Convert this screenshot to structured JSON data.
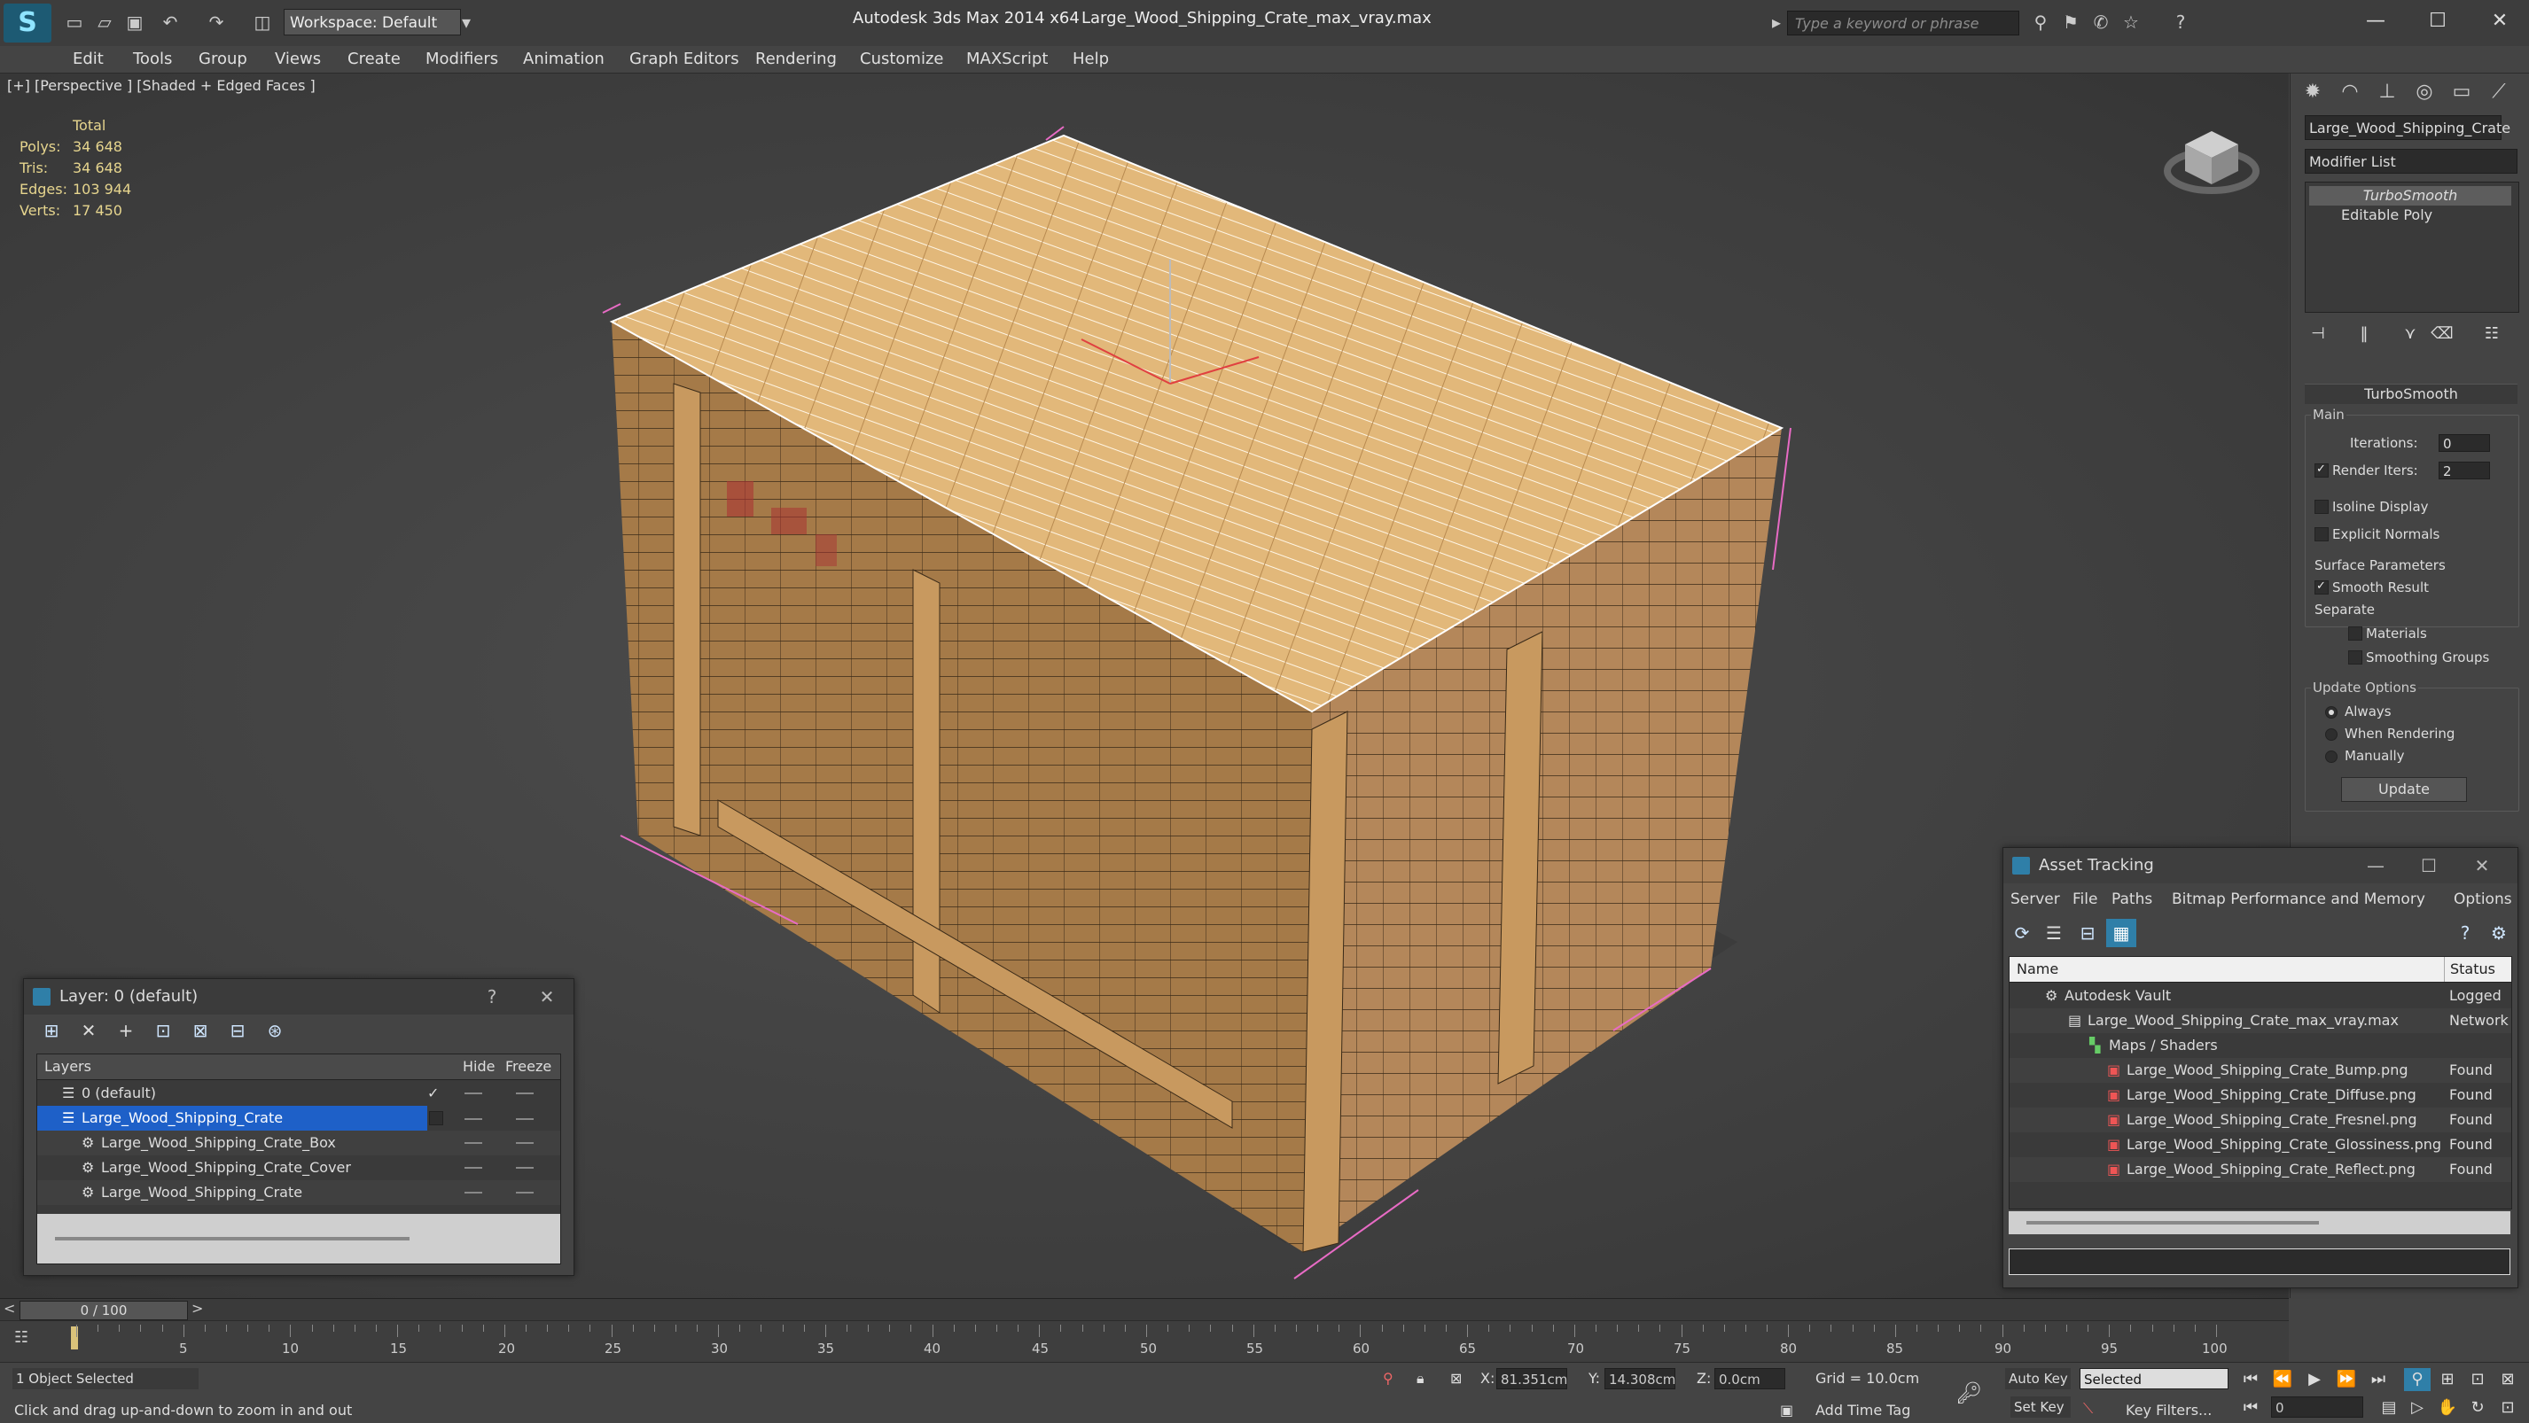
{
  "app": {
    "logo": "S",
    "workspace": "Workspace: Default",
    "title_app": "Autodesk 3ds Max  2014 x64",
    "title_file": "Large_Wood_Shipping_Crate_max_vray.max",
    "search_placeholder": "Type a keyword or phrase"
  },
  "menu": [
    "Edit",
    "Tools",
    "Group",
    "Views",
    "Create",
    "Modifiers",
    "Animation",
    "Graph Editors",
    "Rendering",
    "Customize",
    "MAXScript",
    "Help"
  ],
  "viewport": {
    "label": "[+] [Perspective ] [Shaded + Edged Faces ]",
    "stats": {
      "header": "Total",
      "rows": [
        {
          "k": "Polys:",
          "v": "34 648"
        },
        {
          "k": "Tris:",
          "v": "34 648"
        },
        {
          "k": "Edges:",
          "v": "103 944"
        },
        {
          "k": "Verts:",
          "v": "17 450"
        }
      ]
    }
  },
  "command_panel": {
    "object_name": "Large_Wood_Shipping_Crate",
    "modifier_list": "Modifier List",
    "stack": [
      "TurboSmooth",
      "Editable Poly"
    ],
    "rollout": "TurboSmooth",
    "main_group": "Main",
    "iterations_label": "Iterations:",
    "iterations_value": "0",
    "render_iters_label": "Render Iters:",
    "render_iters_value": "2",
    "isoline": "Isoline Display",
    "explicit_normals": "Explicit Normals",
    "surface_params": "Surface Parameters",
    "smooth_result": "Smooth Result",
    "separate": "Separate",
    "materials": "Materials",
    "smoothing_groups": "Smoothing Groups",
    "update_options": "Update Options",
    "always": "Always",
    "when_rendering": "When Rendering",
    "manually": "Manually",
    "update_btn": "Update"
  },
  "layer_window": {
    "title": "Layer: 0 (default)",
    "help": "?",
    "col_layers": "Layers",
    "col_hide": "Hide",
    "col_freeze": "Freeze",
    "rows": [
      {
        "name": "0 (default)",
        "indent": 1
      },
      {
        "name": "Large_Wood_Shipping_Crate",
        "indent": 1
      },
      {
        "name": "Large_Wood_Shipping_Crate_Box",
        "indent": 2
      },
      {
        "name": "Large_Wood_Shipping_Crate_Cover",
        "indent": 2
      },
      {
        "name": "Large_Wood_Shipping_Crate",
        "indent": 2
      }
    ]
  },
  "asset_window": {
    "title": "Asset Tracking",
    "menu": [
      "Server",
      "File",
      "Paths",
      "Bitmap Performance and Memory",
      "Options"
    ],
    "col_name": "Name",
    "col_status": "Status",
    "rows": [
      {
        "name": "Autodesk Vault",
        "status": "Logged",
        "indent": 1
      },
      {
        "name": "Large_Wood_Shipping_Crate_max_vray.max",
        "status": "Network",
        "indent": 2
      },
      {
        "name": "Maps / Shaders",
        "status": "",
        "indent": 3
      },
      {
        "name": "Large_Wood_Shipping_Crate_Bump.png",
        "status": "Found",
        "indent": 4
      },
      {
        "name": "Large_Wood_Shipping_Crate_Diffuse.png",
        "status": "Found",
        "indent": 4
      },
      {
        "name": "Large_Wood_Shipping_Crate_Fresnel.png",
        "status": "Found",
        "indent": 4
      },
      {
        "name": "Large_Wood_Shipping_Crate_Glossiness.png",
        "status": "Found",
        "indent": 4
      },
      {
        "name": "Large_Wood_Shipping_Crate_Reflect.png",
        "status": "Found",
        "indent": 4
      }
    ]
  },
  "timeline": {
    "slider": "0 / 100",
    "ticks": [
      "5",
      "10",
      "15",
      "20",
      "25",
      "30",
      "35",
      "40",
      "45",
      "50",
      "55",
      "60",
      "65",
      "70",
      "75",
      "80",
      "85",
      "90",
      "95",
      "100"
    ]
  },
  "status": {
    "selected": "1 Object Selected",
    "prompt": "Click and drag up-and-down to zoom in and out",
    "x_label": "X:",
    "x": "81.351cm",
    "y_label": "Y:",
    "y": "14.308cm",
    "z_label": "Z:",
    "z": "0.0cm",
    "grid": "Grid = 10.0cm",
    "add_time_tag": "Add Time Tag",
    "auto_key": "Auto Key",
    "set_key": "Set Key",
    "selected_dropdown": "Selected",
    "key_filters": "Key Filters...",
    "frame": "0"
  }
}
